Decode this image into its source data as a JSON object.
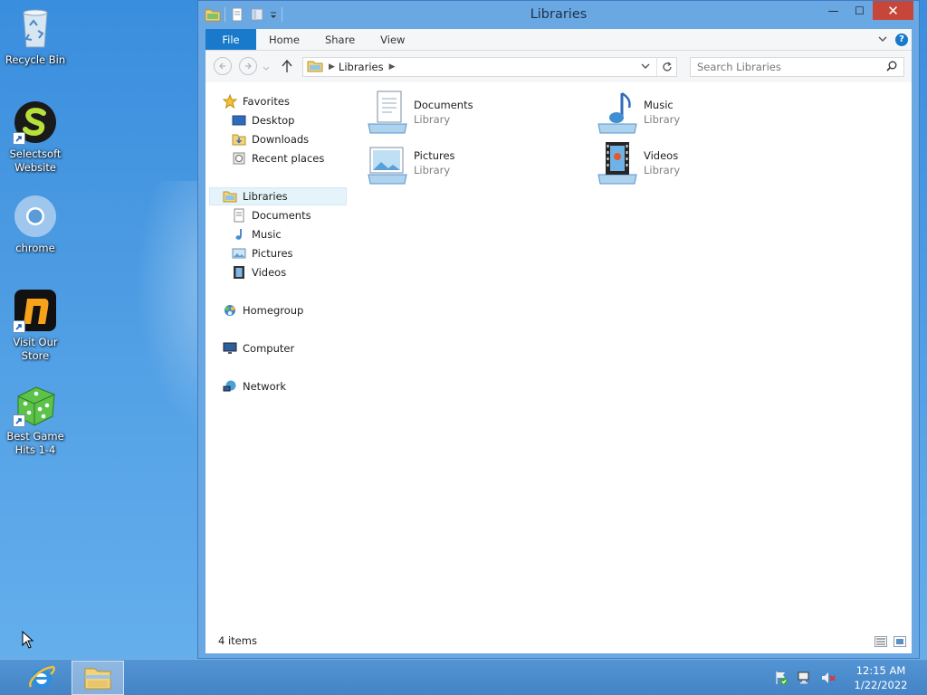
{
  "desktop": {
    "icons": [
      {
        "label": "Recycle Bin"
      },
      {
        "label": "Selectsoft\nWebsite"
      },
      {
        "label": "chrome"
      },
      {
        "label": "Visit Our\nStore"
      },
      {
        "label": "Best Game\nHits 1-4"
      }
    ]
  },
  "window": {
    "title": "Libraries",
    "controls": {
      "minimize": "—",
      "maximize": "☐",
      "close": "✕"
    },
    "ribbon_tabs": [
      "File",
      "Home",
      "Share",
      "View"
    ],
    "help": "?",
    "address": {
      "root_crumb": "Libraries"
    },
    "search": {
      "placeholder": "Search Libraries"
    },
    "nav": {
      "favorites": "Favorites",
      "fav_items": [
        "Desktop",
        "Downloads",
        "Recent places"
      ],
      "libraries": "Libraries",
      "lib_items": [
        "Documents",
        "Music",
        "Pictures",
        "Videos"
      ],
      "homegroup": "Homegroup",
      "computer": "Computer",
      "network": "Network"
    },
    "items": [
      {
        "name": "Documents",
        "type": "Library"
      },
      {
        "name": "Music",
        "type": "Library"
      },
      {
        "name": "Pictures",
        "type": "Library"
      },
      {
        "name": "Videos",
        "type": "Library"
      }
    ],
    "status": "4 items"
  },
  "taskbar": {
    "time": "12:15 AM",
    "date": "1/22/2022"
  },
  "colors": {
    "accent": "#1979ca",
    "close": "#c7463a",
    "desktop": "#4a9ae2"
  }
}
